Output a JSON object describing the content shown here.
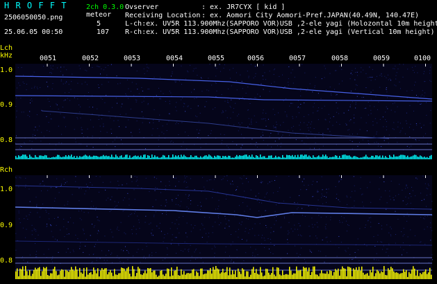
{
  "header": {
    "logo": "H R O F F T",
    "mode": "2ch 0.3.0",
    "filename": "2506050050.png",
    "datetime": "25.06.05 00:50",
    "meteor_label": "meteor",
    "meteor_lch": "5",
    "meteor_rch": "107",
    "observer_label": "Ovserver",
    "observer_value": ": ex. JR7CYX [ kid ]",
    "location_label": "Receiving Location",
    "location_value": ": ex. Aomori City Aomori-Pref.JAPAN(40.49N, 140.47E)",
    "lch_line": "L-ch:ex. UV5R 113.900Mhz(SAPPORO VOR)USB ,2-ele yagi (Holozontal 10m height",
    "rch_line": "R-ch:ex. UV5R 113.900Mhz(SAPPORO VOR)USB ,2-ele yagi (Vertical 10m height)"
  },
  "lch": {
    "label": "Lch",
    "unit": "kHz",
    "yticks": [
      "1.0",
      "0.9",
      "0.8"
    ]
  },
  "rch": {
    "label": "Rch",
    "yticks": [
      "1.0",
      "0.9",
      "0.8"
    ]
  },
  "time_ticks": [
    "0051",
    "0052",
    "0053",
    "0054",
    "0055",
    "0056",
    "0057",
    "0058",
    "0059",
    "0100"
  ],
  "colors": {
    "background": "#000000",
    "accent_cyan": "#00ffff",
    "text_white": "#ffffff",
    "rch_bars": "#ffff00",
    "lch_bars": "#00ffff",
    "noise": "#1a2a8a"
  }
}
